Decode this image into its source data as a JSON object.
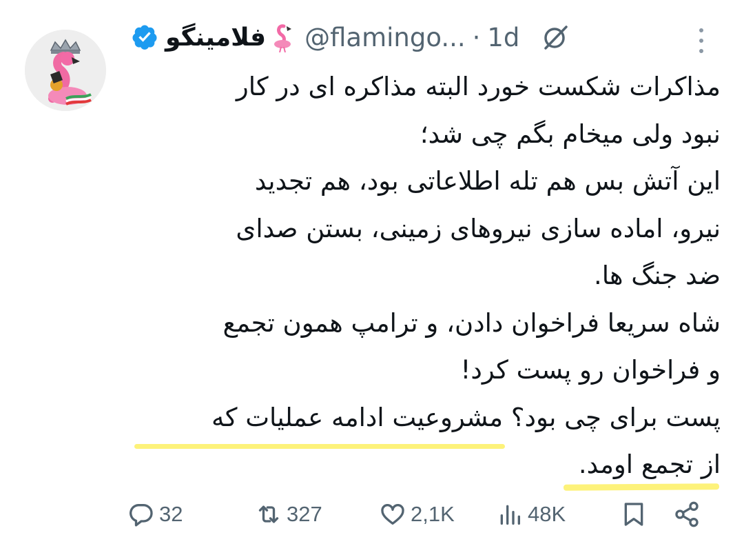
{
  "tweet": {
    "author": {
      "display_name": "فلامینگو",
      "name_emoji": "flamingo-emoji",
      "handle": "@flamingo...",
      "verified": true,
      "avatar": "crowned-flamingo-avatar"
    },
    "separator": "·",
    "timestamp": "1d",
    "header_icons": [
      "grok-icon",
      "more-icon"
    ],
    "text_lines": [
      "مذاکرات شکست خورد البته مذاکره ای در کار",
      "نبود ولی میخام بگم چی شد؛",
      "این آتش بس هم تله اطلاعاتی بود، هم تجدید",
      "نیرو، اماده سازی نیروهای زمینی، بستن صدای",
      "ضد جنگ ها.",
      "شاه سریعا فراخوان دادن، و ترامپ همون تجمع",
      "و فراخوان رو پست کرد!",
      "پست برای چی بود؟ مشروعیت ادامه عملیات که",
      "از تجمع اومد."
    ],
    "highlight_color": "#fdf27a",
    "actions": {
      "reply": {
        "icon": "reply-icon",
        "count": "32"
      },
      "repost": {
        "icon": "repost-icon",
        "count": "327"
      },
      "like": {
        "icon": "like-icon",
        "count": "2,1K"
      },
      "views": {
        "icon": "views-icon",
        "count": "48K"
      },
      "bookmark": {
        "icon": "bookmark-icon"
      },
      "share": {
        "icon": "share-icon"
      }
    },
    "colors": {
      "text": "#0f1419",
      "secondary": "#536471",
      "verified": "#1d9bf0"
    }
  }
}
